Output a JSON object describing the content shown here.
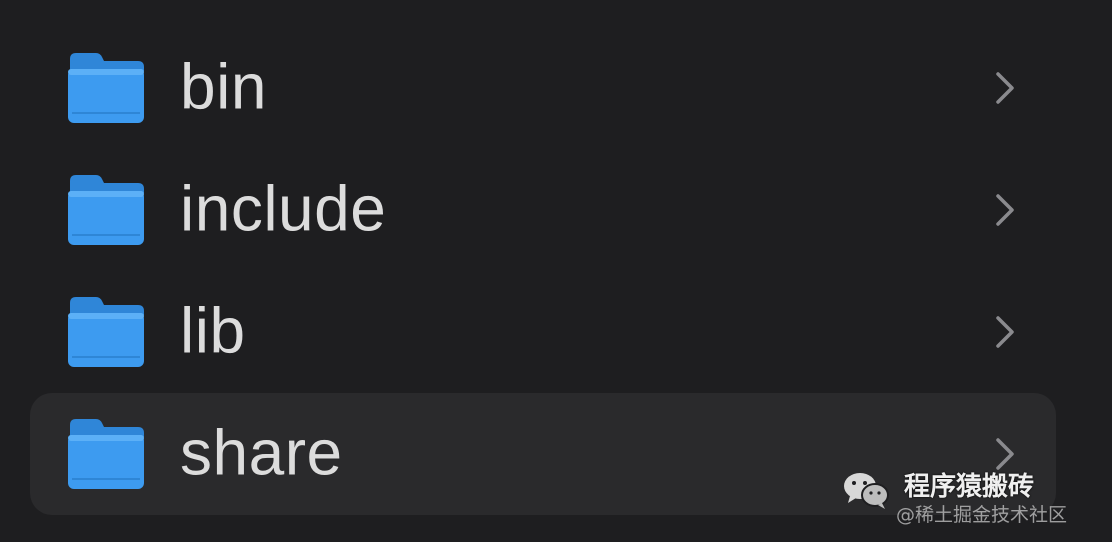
{
  "folders": [
    {
      "name": "bin",
      "icon": "folder-icon",
      "selected": false
    },
    {
      "name": "include",
      "icon": "folder-icon",
      "selected": false
    },
    {
      "name": "lib",
      "icon": "folder-icon",
      "selected": false
    },
    {
      "name": "share",
      "icon": "folder-icon",
      "selected": true
    }
  ],
  "watermark": {
    "name": "程序猿搬砖",
    "subtitle": "@稀土掘金技术社区",
    "icon": "wechat-icon"
  },
  "colors": {
    "background": "#1e1e20",
    "selected_row": "#2a2a2c",
    "folder_blue": "#3d9bf0",
    "label_text": "#dcdcdc",
    "chevron": "#8a8a8e"
  }
}
